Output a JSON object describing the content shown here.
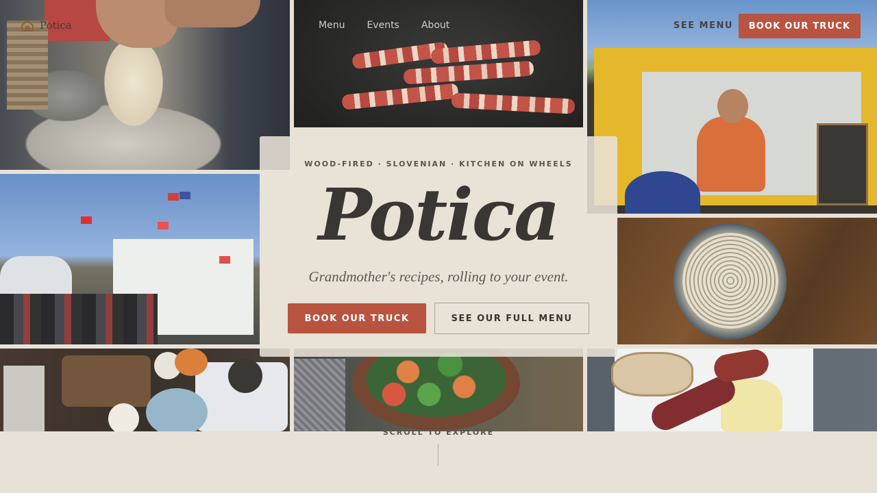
{
  "brand": {
    "name": "Potica",
    "logo_icon": "house-icon"
  },
  "nav": {
    "items": [
      {
        "label": "Menu"
      },
      {
        "label": "Events"
      },
      {
        "label": "About"
      }
    ],
    "see_menu_label": "SEE MENU",
    "book_label": "BOOK OUR TRUCK"
  },
  "hero": {
    "tagline": "WOOD-FIRED · SLOVENIAN · KITCHEN ON WHEELS",
    "title": "Potica",
    "subtitle": "Grandmother's recipes, rolling to your event.",
    "primary_cta": "BOOK OUR TRUCK",
    "secondary_cta": "SEE OUR FULL MENU"
  },
  "scroll_hint": "SCROLL TO EXPLORE",
  "colors": {
    "accent": "#b85440",
    "background": "#e8e1d7",
    "text_dark": "#3a3633"
  },
  "gallery": [
    {
      "subject": "dough-stretching-photo"
    },
    {
      "subject": "bacon-skillet-photo"
    },
    {
      "subject": "food-truck-chef-photo"
    },
    {
      "subject": "ferry-flags-photo"
    },
    {
      "subject": "seeds-bowl-photo"
    },
    {
      "subject": "breakfast-spread-photo"
    },
    {
      "subject": "vegetable-pan-photo"
    },
    {
      "subject": "bread-sausage-photo"
    }
  ]
}
